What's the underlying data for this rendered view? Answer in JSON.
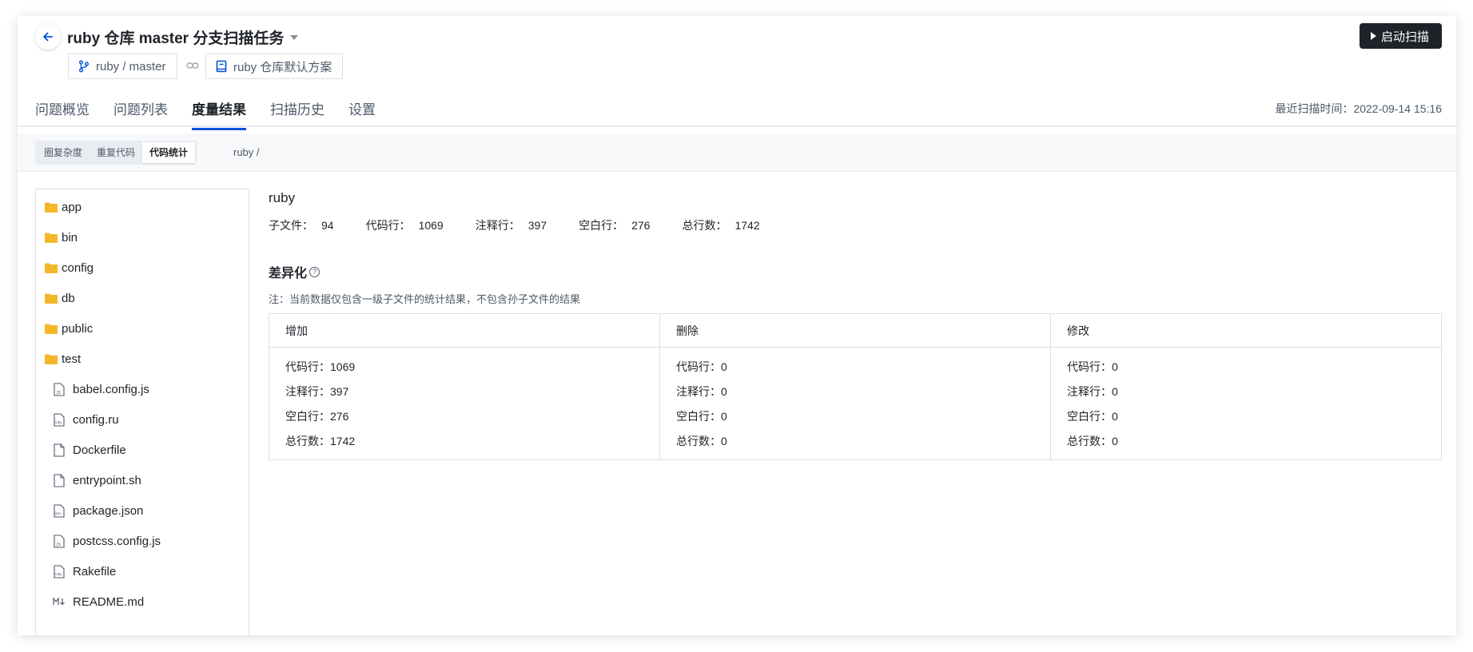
{
  "header": {
    "title": "ruby 仓库 master 分支扫描任务",
    "branch": "ruby / master",
    "scheme": "ruby 仓库默认方案",
    "start_scan_label": "启动扫描"
  },
  "tabs": [
    {
      "label": "问题概览",
      "active": false
    },
    {
      "label": "问题列表",
      "active": false
    },
    {
      "label": "度量结果",
      "active": true
    },
    {
      "label": "扫描历史",
      "active": false
    },
    {
      "label": "设置",
      "active": false
    }
  ],
  "last_scan": "最近扫描时间：2022-09-14 15:16",
  "subtabs": [
    {
      "label": "圈复杂度",
      "active": false
    },
    {
      "label": "重复代码",
      "active": false
    },
    {
      "label": "代码统计",
      "active": true
    }
  ],
  "breadcrumb": "ruby /",
  "tree": {
    "folders": [
      "app",
      "bin",
      "config",
      "db",
      "public",
      "test"
    ],
    "files": [
      {
        "name": "babel.config.js",
        "icon": "js-file-icon"
      },
      {
        "name": "config.ru",
        "icon": "ruby-file-icon"
      },
      {
        "name": "Dockerfile",
        "icon": "file-icon"
      },
      {
        "name": "entrypoint.sh",
        "icon": "file-icon"
      },
      {
        "name": "package.json",
        "icon": "json-file-icon"
      },
      {
        "name": "postcss.config.js",
        "icon": "js-file-icon"
      },
      {
        "name": "Rakefile",
        "icon": "ruby-file-icon"
      },
      {
        "name": "README.md",
        "icon": "markdown-file-icon"
      }
    ]
  },
  "summary": {
    "name": "ruby",
    "stats": [
      {
        "label": "子文件：",
        "value": "94"
      },
      {
        "label": "代码行：",
        "value": "1069"
      },
      {
        "label": "注释行：",
        "value": "397"
      },
      {
        "label": "空白行：",
        "value": "276"
      },
      {
        "label": "总行数：",
        "value": "1742"
      }
    ]
  },
  "diff": {
    "title": "差异化",
    "note": "注：当前数据仅包含一级子文件的统计结果，不包含孙子文件的结果",
    "columns": [
      {
        "header": "增加",
        "rows": [
          "代码行：1069",
          "注释行：397",
          "空白行：276",
          "总行数：1742"
        ]
      },
      {
        "header": "删除",
        "rows": [
          "代码行：0",
          "注释行：0",
          "空白行：0",
          "总行数：0"
        ]
      },
      {
        "header": "修改",
        "rows": [
          "代码行：0",
          "注释行：0",
          "空白行：0",
          "总行数：0"
        ]
      }
    ]
  },
  "colors": {
    "accent": "#0052d9",
    "folder": "#f5b72a",
    "dark_button": "#1f2329"
  }
}
